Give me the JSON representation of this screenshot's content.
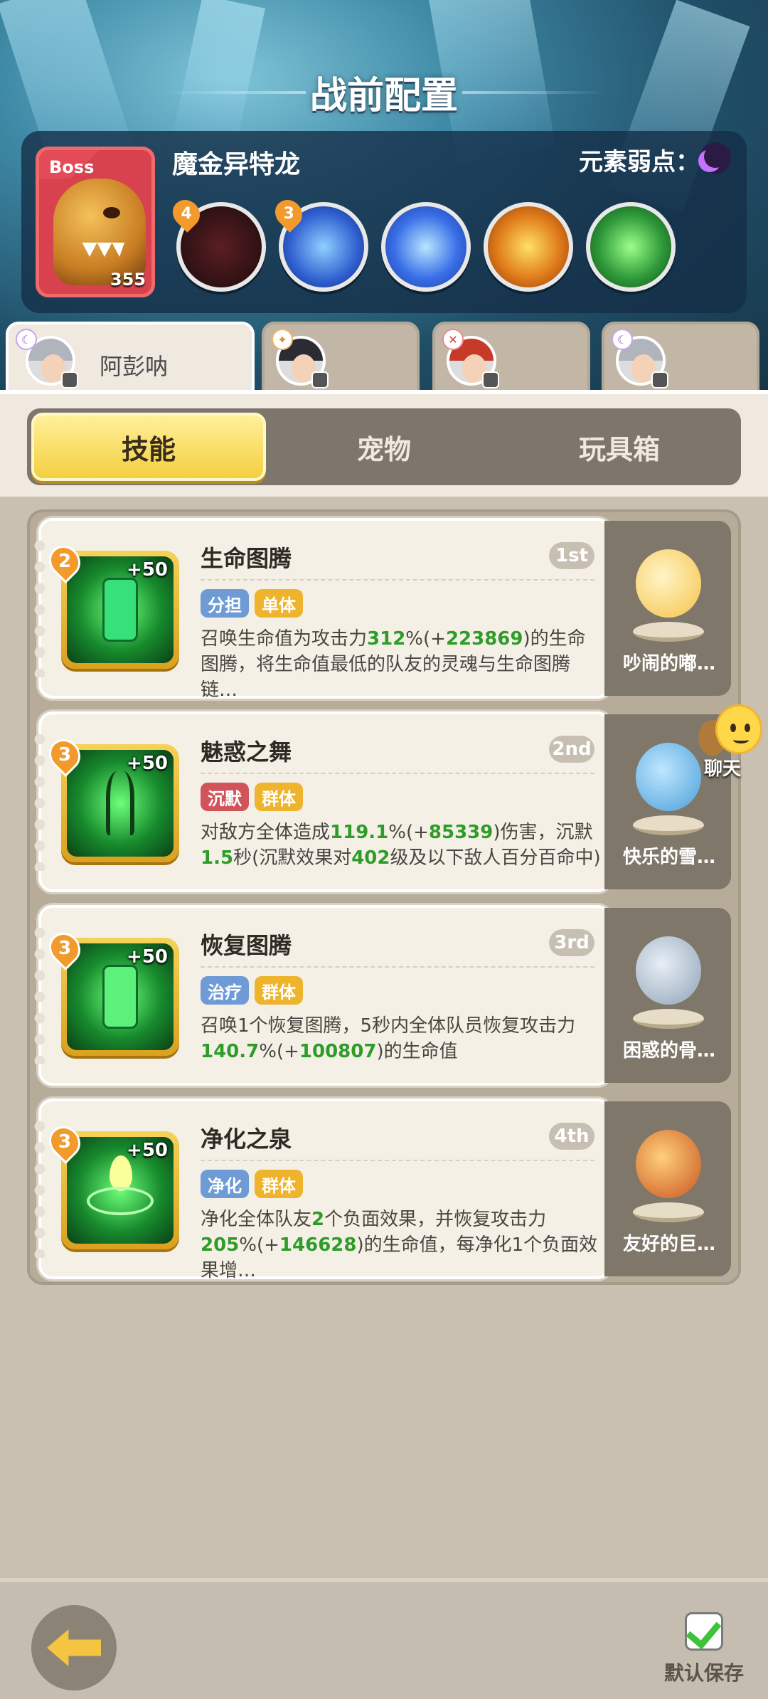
{
  "header": {
    "title": "战前配置"
  },
  "boss": {
    "tag": "Boss",
    "name": "魔金异特龙",
    "level": "355",
    "weakness_label": "元素弱点：",
    "weakness_icon": "moon-icon",
    "skills": [
      {
        "icon": "monster-mouth-icon",
        "badge": "4",
        "color": "#3b1c1f"
      },
      {
        "icon": "lightning-claw-icon",
        "badge": "3",
        "color": "#2f5fd0"
      },
      {
        "icon": "lightning-bolt-icon",
        "badge": "",
        "color": "#3a6fe8"
      },
      {
        "icon": "spiked-crown-icon",
        "badge": "",
        "color": "#e07b1a"
      },
      {
        "icon": "green-slime-icon",
        "badge": "",
        "color": "#2f9a3a"
      }
    ]
  },
  "heroes": [
    {
      "name": "阿彭呐",
      "element": "purple",
      "active": true
    },
    {
      "name": "",
      "element": "orange",
      "active": false
    },
    {
      "name": "",
      "element": "red",
      "active": false
    },
    {
      "name": "",
      "element": "purple",
      "active": false
    }
  ],
  "tabs": [
    "技能",
    "宠物",
    "玩具箱"
  ],
  "skills": [
    {
      "name": "生命图腾",
      "order": "1st",
      "level": "2",
      "bonus": "+50",
      "tags": [
        {
          "text": "分担",
          "color": "blue"
        },
        {
          "text": "单体",
          "color": "yellow"
        }
      ],
      "desc": [
        "召唤生命值为攻击力",
        "312",
        "%(+",
        "223869",
        ")的生命图腾，将生命值最低的队友的灵魂与生命图腾链…"
      ],
      "pet": "吵闹的嘟…"
    },
    {
      "name": "魅惑之舞",
      "order": "2nd",
      "level": "3",
      "bonus": "+50",
      "tags": [
        {
          "text": "沉默",
          "color": "red"
        },
        {
          "text": "群体",
          "color": "yellow"
        }
      ],
      "desc": [
        "对敌方全体造成",
        "119.1",
        "%(+",
        "85339",
        ")伤害，沉默",
        "1.5",
        "秒(沉默效果对",
        "402",
        "级及以下敌人百分百命中)"
      ],
      "pet": "快乐的雪…"
    },
    {
      "name": "恢复图腾",
      "order": "3rd",
      "level": "3",
      "bonus": "+50",
      "tags": [
        {
          "text": "治疗",
          "color": "blue"
        },
        {
          "text": "群体",
          "color": "yellow"
        }
      ],
      "desc": [
        "召唤1个恢复图腾，5秒内全体队员恢复攻击力",
        "140.7",
        "%(+",
        "100807",
        ")的生命值"
      ],
      "pet": "困惑的骨…"
    },
    {
      "name": "净化之泉",
      "order": "4th",
      "level": "3",
      "bonus": "+50",
      "tags": [
        {
          "text": "净化",
          "color": "blue"
        },
        {
          "text": "群体",
          "color": "yellow"
        }
      ],
      "desc": [
        "净化全体队友",
        "2",
        "个负面效果，并恢复攻击力",
        "205",
        "%(+",
        "146628",
        ")的生命值，每净化1个负面效果增…"
      ],
      "pet": "友好的巨…"
    }
  ],
  "chat": {
    "label": "聊天"
  },
  "footer": {
    "save_label": "默认保存",
    "back_icon": "back-arrow-icon"
  }
}
